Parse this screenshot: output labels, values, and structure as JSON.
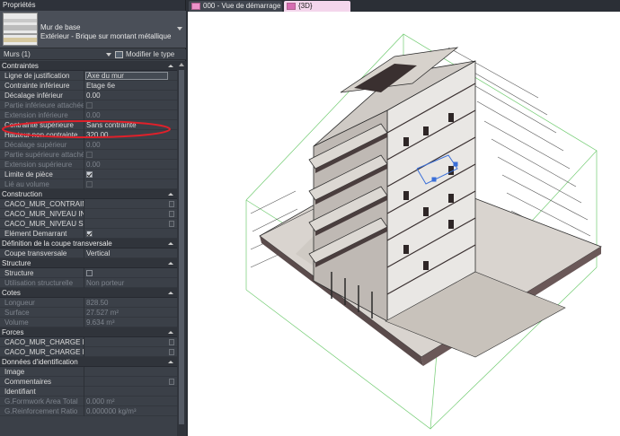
{
  "panel": {
    "title": "Propriétés",
    "type_name": "Mur de base",
    "type_sub": "Extérieur - Brique sur montant métallique",
    "selection": "Murs (1)",
    "edit_type": "Modifier le type"
  },
  "sections": {
    "contraintes": "Contraintes",
    "construction": "Construction",
    "coupe": "Définition de la coupe transversale",
    "structure": "Structure",
    "cotes": "Cotes",
    "forces": "Forces",
    "identification": "Données d'identification"
  },
  "props": {
    "ligne_justif": {
      "label": "Ligne de justification",
      "value": "Axe du mur"
    },
    "contrainte_inf": {
      "label": "Contrainte inférieure",
      "value": "Etage 6e"
    },
    "decalage_inf": {
      "label": "Décalage inférieur",
      "value": "0.00"
    },
    "partie_inf": {
      "label": "Partie inférieure attachée"
    },
    "extension_inf": {
      "label": "Extension inférieure",
      "value": "0.00"
    },
    "contrainte_sup": {
      "label": "Contrainte supérieure",
      "value": "Sans contrainte"
    },
    "hauteur_non": {
      "label": "Hauteur non contrainte",
      "value": "320.00"
    },
    "decalage_sup": {
      "label": "Décalage supérieur",
      "value": "0.00"
    },
    "partie_sup": {
      "label": "Partie supérieure attachée"
    },
    "extension_sup": {
      "label": "Extension supérieure",
      "value": "0.00"
    },
    "limite_piece": {
      "label": "Limite de pièce"
    },
    "lie_volume": {
      "label": "Lié au volume"
    },
    "caco1": {
      "label": "CACO_MUR_CONTRAINTE ..."
    },
    "caco2": {
      "label": "CACO_MUR_NIVEAU INFE..."
    },
    "caco3": {
      "label": "CACO_MUR_NIVEAU SUPE..."
    },
    "element_dem": {
      "label": "Elément Demarrant"
    },
    "coupe_trans": {
      "label": "Coupe transversale",
      "value": "Vertical"
    },
    "structure": {
      "label": "Structure"
    },
    "util_struct": {
      "label": "Utilisation structurelle",
      "value": "Non porteur"
    },
    "longueur": {
      "label": "Longueur",
      "value": "828.50"
    },
    "surface": {
      "label": "Surface",
      "value": "27.527 m²"
    },
    "volume": {
      "label": "Volume",
      "value": "9.634 m³"
    },
    "charge1": {
      "label": "CACO_MUR_CHARGE D'EX..."
    },
    "charge2": {
      "label": "CACO_MUR_CHARGE PER..."
    },
    "image": {
      "label": "Image"
    },
    "commentaires": {
      "label": "Commentaires"
    },
    "identifiant": {
      "label": "Identifiant"
    },
    "formwork": {
      "label": "G.Formwork Area Total",
      "value": "0.000 m²"
    },
    "reinforcement": {
      "label": "G.Reinforcement Ratio",
      "value": "0.000000 kg/m³"
    }
  },
  "tabs": [
    {
      "label": "000 - Vue de démarrage"
    },
    {
      "label": "{3D}"
    }
  ],
  "colors": {
    "highlight_ellipse": "#e0202a",
    "tab_active": "#f4d6ec",
    "panel_bg": "#3b4048"
  }
}
